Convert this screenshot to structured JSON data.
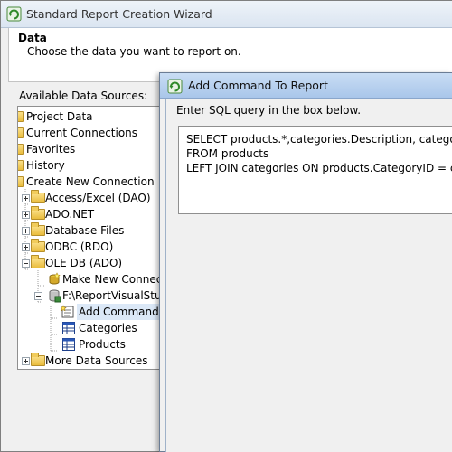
{
  "wizard": {
    "title": "Standard Report Creation Wizard",
    "header_title": "Data",
    "header_subtitle": "Choose the data you want to report on."
  },
  "sources": {
    "label": "Available Data Sources:",
    "items": [
      {
        "label": "Project Data",
        "icon": "folder-icon"
      },
      {
        "label": "Current Connections",
        "icon": "folder-icon"
      },
      {
        "label": "Favorites",
        "icon": "folder-icon"
      },
      {
        "label": "History",
        "icon": "folder-icon"
      },
      {
        "label": "Create New Connection",
        "icon": "folder-icon"
      },
      {
        "label": "Access/Excel (DAO)",
        "icon": "folder-icon"
      },
      {
        "label": "ADO.NET",
        "icon": "folder-icon"
      },
      {
        "label": "Database Files",
        "icon": "folder-icon"
      },
      {
        "label": "ODBC (RDO)",
        "icon": "folder-icon"
      },
      {
        "label": "OLE DB (ADO)",
        "icon": "folder-icon"
      },
      {
        "label": "Make New Connection",
        "icon": "new-connection-icon"
      },
      {
        "label": "F:\\ReportVisualStudio",
        "icon": "database-icon"
      },
      {
        "label": "Add Command",
        "icon": "add-command-icon"
      },
      {
        "label": "Categories",
        "icon": "table-icon"
      },
      {
        "label": "Products",
        "icon": "table-icon"
      },
      {
        "label": "More Data Sources",
        "icon": "folder-icon"
      }
    ]
  },
  "dialog": {
    "title": "Add Command To Report",
    "instruction": "Enter SQL query in the box below.",
    "sql_lines": [
      "SELECT products.*,categories.Description, categories.Ma",
      "FROM products",
      "LEFT JOIN categories ON products.CategoryID = categor"
    ]
  }
}
